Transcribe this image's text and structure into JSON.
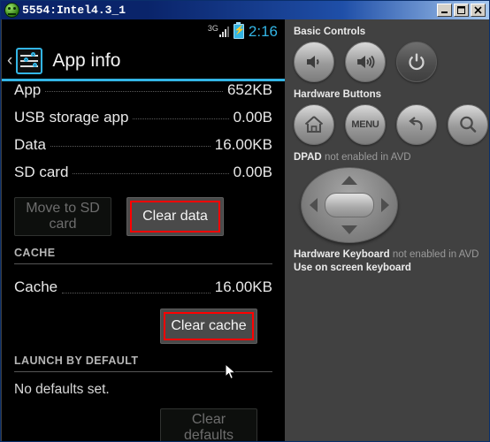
{
  "window": {
    "title": "5554:Intel4.3_1",
    "icon": "android-head-icon",
    "minimize_label": "–",
    "maximize_label": "□",
    "close_label": "✕"
  },
  "device": {
    "statusbar": {
      "network": "3G",
      "signal_icon": "signal-bars-icon",
      "battery_icon": "battery-charging-icon",
      "time": "2:16"
    },
    "header": {
      "back_icon": "back-chevron-icon",
      "app_icon": "settings-sliders-icon",
      "title": "App info",
      "accent_color": "#33b5e5"
    },
    "storage_rows": [
      {
        "label": "App",
        "value": "652KB"
      },
      {
        "label": "USB storage app",
        "value": "0.00B"
      },
      {
        "label": "Data",
        "value": "16.00KB"
      },
      {
        "label": "SD card",
        "value": "0.00B"
      }
    ],
    "storage_buttons": {
      "move_to_sd": "Move to SD card",
      "clear_data": "Clear data"
    },
    "cache_section": {
      "header": "CACHE",
      "row": {
        "label": "Cache",
        "value": "16.00KB"
      },
      "clear_cache": "Clear cache"
    },
    "launch_section": {
      "header": "LAUNCH BY DEFAULT",
      "text": "No defaults set.",
      "clear_defaults": "Clear defaults"
    },
    "annotation_color": "#ff0000"
  },
  "panel": {
    "basic_controls": {
      "label": "Basic Controls",
      "buttons": [
        {
          "name": "volume-down-button",
          "icon": "volume-down-icon"
        },
        {
          "name": "volume-up-button",
          "icon": "volume-up-icon"
        },
        {
          "name": "power-button",
          "icon": "power-icon"
        }
      ]
    },
    "hardware_buttons": {
      "label": "Hardware Buttons",
      "buttons": [
        {
          "name": "home-button",
          "icon": "home-icon",
          "text": ""
        },
        {
          "name": "menu-button",
          "icon": "menu-icon",
          "text": "MENU"
        },
        {
          "name": "back-button",
          "icon": "back-arrow-icon",
          "text": ""
        },
        {
          "name": "search-button",
          "icon": "search-icon",
          "text": ""
        }
      ]
    },
    "dpad": {
      "label_strong": "DPAD",
      "label_dim": "not enabled in AVD"
    },
    "keyboard": {
      "label_strong": "Hardware Keyboard",
      "label_dim": "not enabled in AVD",
      "line2": "Use on screen keyboard"
    }
  }
}
